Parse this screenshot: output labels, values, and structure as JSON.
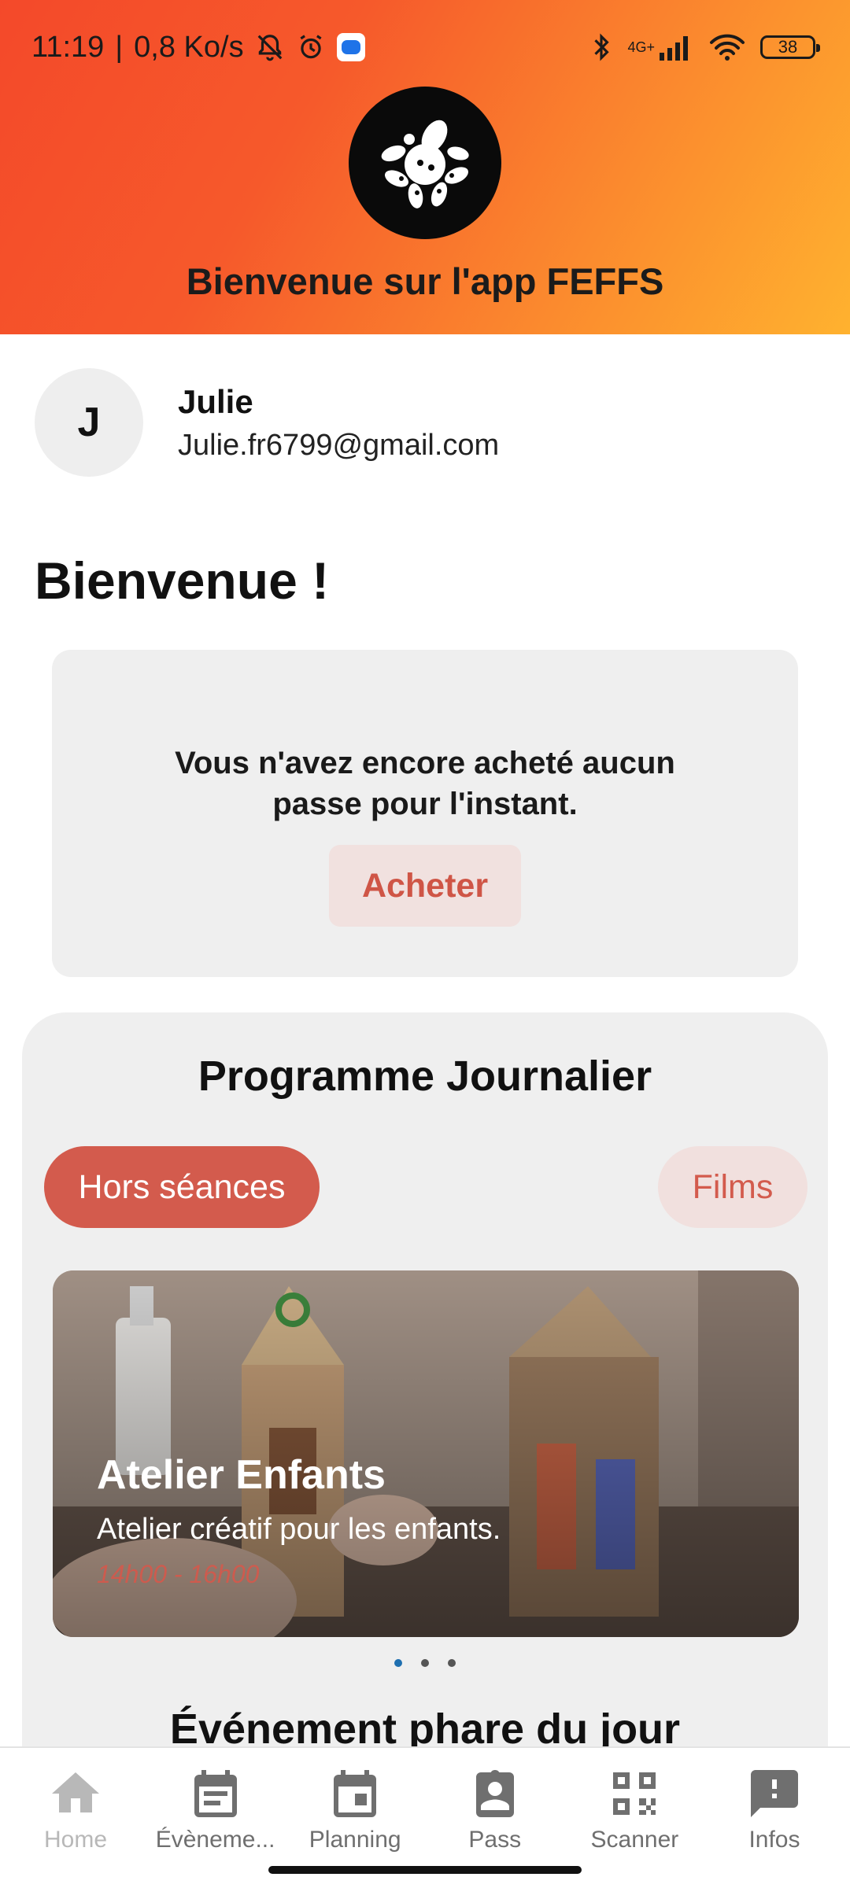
{
  "status_bar": {
    "time": "11:19",
    "separator": "|",
    "speed": "0,8 Ko/s",
    "network_label": "4G+",
    "battery": "38"
  },
  "header": {
    "title": "Bienvenue sur l'app FEFFS",
    "background_colors": [
      "#f4492a",
      "#ffb22f"
    ]
  },
  "profile": {
    "initial": "J",
    "name": "Julie",
    "email": "Julie.fr6799@gmail.com"
  },
  "welcome": "Bienvenue !",
  "pass_card": {
    "message_line1": "Vous n'avez encore acheté aucun",
    "message_line2": "passe pour l'instant.",
    "buy_label": "Acheter"
  },
  "programme": {
    "title": "Programme Journalier",
    "tabs": [
      {
        "label": "Hors séances",
        "active": true
      },
      {
        "label": "Films",
        "active": false
      }
    ],
    "event": {
      "title": "Atelier Enfants",
      "description": "Atelier créatif pour les enfants.",
      "time": "14h00 - 16h00"
    },
    "carousel_page": 1,
    "carousel_pages": 3,
    "highlight_title": "Événement phare du jour"
  },
  "nav": {
    "items": [
      {
        "label": "Home",
        "icon": "home-icon",
        "active": true
      },
      {
        "label": "Évèneme...",
        "icon": "events-icon",
        "active": false
      },
      {
        "label": "Planning",
        "icon": "calendar-icon",
        "active": false
      },
      {
        "label": "Pass",
        "icon": "badge-icon",
        "active": false
      },
      {
        "label": "Scanner",
        "icon": "qr-code-icon",
        "active": false
      },
      {
        "label": "Infos",
        "icon": "alert-message-icon",
        "active": false
      }
    ]
  },
  "colors": {
    "accent": "#d35b4d",
    "accent_light": "#f1e0de",
    "card_bg": "#efefef"
  }
}
